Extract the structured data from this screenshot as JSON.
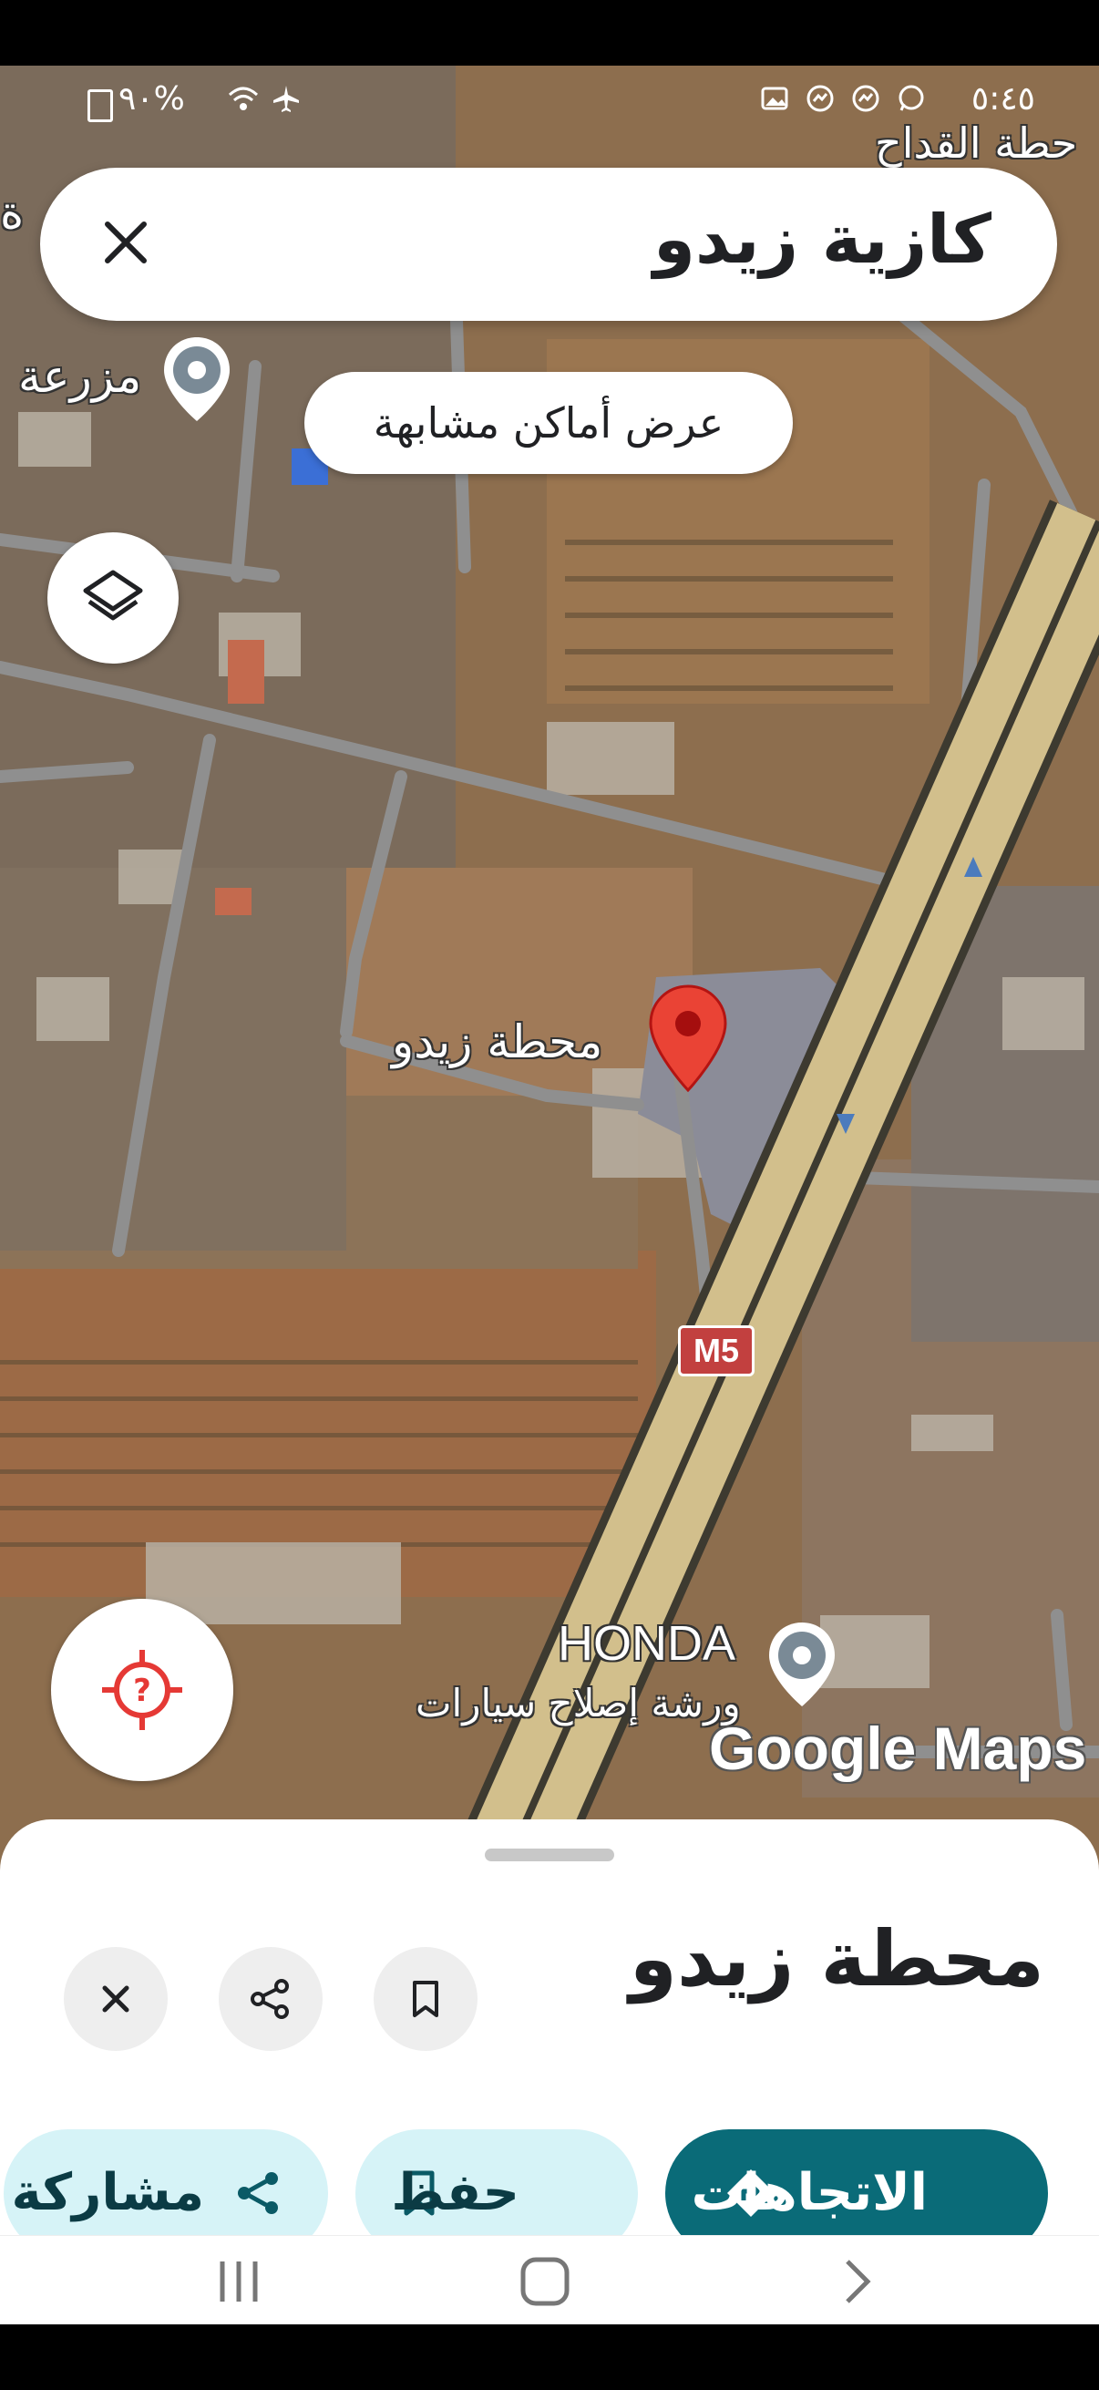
{
  "status_bar": {
    "time": "٥:٤٥",
    "battery": "٩٠%",
    "icons": [
      "whatsapp-icon",
      "messenger-icon",
      "messenger-icon",
      "gallery-icon",
      "wifi-icon",
      "airplane-icon",
      "battery-icon"
    ]
  },
  "search": {
    "query": "كازية زيدو",
    "close_icon": "close-icon"
  },
  "similar_places_button": "عرض أماكن مشابهة",
  "map": {
    "labels": {
      "station_top_right": "حطة القداح",
      "farm": "مزرعة",
      "edge_left": "ة",
      "selected_place": "محطة زيدو",
      "route_shield": "M5",
      "honda_name": "HONDA",
      "honda_category": "ورشة إصلاح سيارات"
    },
    "watermark": "Google Maps",
    "marker_color": "#ea4335",
    "road_color": "#d2bf8c"
  },
  "place_sheet": {
    "title": "محطة زيدو",
    "buttons": {
      "close_icon": "close-icon",
      "share_icon": "share-icon",
      "save_icon": "bookmark-icon"
    },
    "actions": {
      "directions": "الاتجاهات",
      "save": "حفظ",
      "share": "مشاركة"
    },
    "colors": {
      "primary": "#0a6b78",
      "secondary_bg": "#d6f3f7"
    }
  },
  "navigation_bar": [
    "recent-apps-icon",
    "home-icon",
    "back-icon"
  ]
}
